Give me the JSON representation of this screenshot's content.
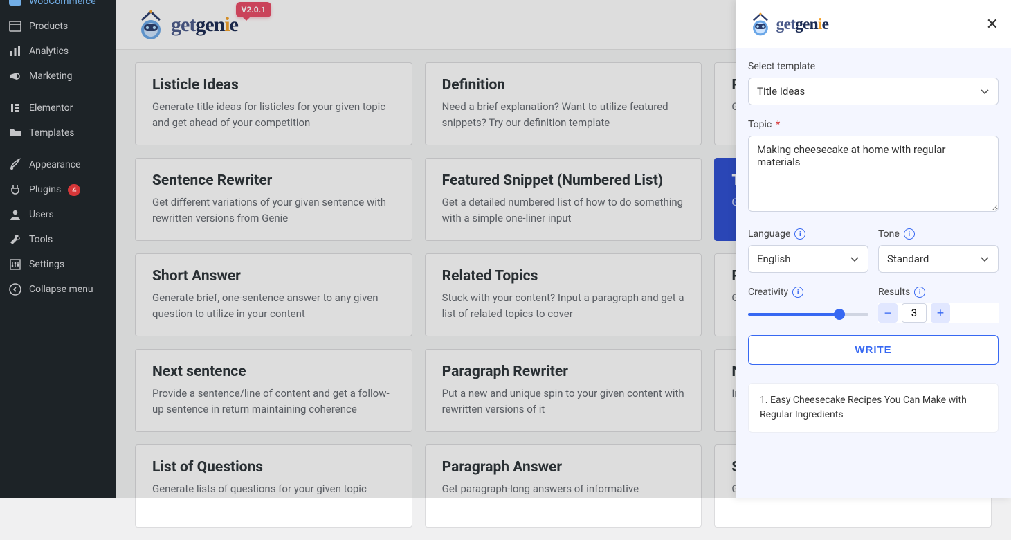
{
  "brand": {
    "name": "getgenie",
    "version": "V2.0.1"
  },
  "wp_sidebar": [
    {
      "id": "woocommerce",
      "label": "WooCommerce",
      "icon": "woo"
    },
    {
      "id": "products",
      "label": "Products",
      "icon": "box"
    },
    {
      "id": "analytics",
      "label": "Analytics",
      "icon": "bars"
    },
    {
      "id": "marketing",
      "label": "Marketing",
      "icon": "megaphone"
    },
    {
      "gap": true
    },
    {
      "id": "elementor",
      "label": "Elementor",
      "icon": "elementor"
    },
    {
      "id": "templates",
      "label": "Templates",
      "icon": "folder"
    },
    {
      "gap": true
    },
    {
      "id": "appearance",
      "label": "Appearance",
      "icon": "brush"
    },
    {
      "id": "plugins",
      "label": "Plugins",
      "icon": "plug",
      "badge": "4"
    },
    {
      "id": "users",
      "label": "Users",
      "icon": "user"
    },
    {
      "id": "tools",
      "label": "Tools",
      "icon": "wrench"
    },
    {
      "id": "settings",
      "label": "Settings",
      "icon": "sliders"
    },
    {
      "id": "collapse",
      "label": "Collapse menu",
      "icon": "collapse"
    }
  ],
  "cards": [
    {
      "title": "Listicle Ideas",
      "desc": "Generate title ideas for listicles for your given topic and get ahead of your competition"
    },
    {
      "title": "Definition",
      "desc": "Need a brief explanation? Want to utilize featured snippets? Try our definition template"
    },
    {
      "title": "Pro",
      "desc": "Gen inpu"
    },
    {
      "title": "Sentence Rewriter",
      "desc": "Get different variations of your given sentence with rewritten versions from Genie"
    },
    {
      "title": "Featured Snippet (Numbered List)",
      "desc": "Get a detailed numbered list of how to do something with a simple one-liner input"
    },
    {
      "title": "Til",
      "desc": "Get varia",
      "active": true
    },
    {
      "title": "Short Answer",
      "desc": "Generate brief, one-sentence answer to any given question to utilize in your content"
    },
    {
      "title": "Related Topics",
      "desc": "Stuck with your content? Input a paragraph and get a list of related topics to cover"
    },
    {
      "title": "Pa",
      "desc": "Gen the"
    },
    {
      "title": "Next sentence",
      "desc": "Provide a sentence/line of content and get a follow-up sentence in return maintaining coherence"
    },
    {
      "title": "Paragraph Rewriter",
      "desc": "Put a new and unique spin to your given content with rewritten versions of it"
    },
    {
      "title": "Ne",
      "desc": "Inpu con"
    },
    {
      "title": "List of Questions",
      "desc": "Generate lists of questions for your given topic"
    },
    {
      "title": "Paragraph Answer",
      "desc": "Get paragraph-long answers of informative"
    },
    {
      "title": "Su",
      "desc": "Get"
    }
  ],
  "drawer": {
    "template_label": "Select template",
    "template_value": "Title Ideas",
    "topic_label": "Topic",
    "topic_value": "Making cheesecake at home with regular materials",
    "language_label": "Language",
    "language_value": "English",
    "tone_label": "Tone",
    "tone_value": "Standard",
    "creativity_label": "Creativity",
    "results_label": "Results",
    "results_value": "3",
    "write_label": "WRITE",
    "output": [
      "1. Easy Cheesecake Recipes You Can Make with Regular Ingredients"
    ]
  }
}
